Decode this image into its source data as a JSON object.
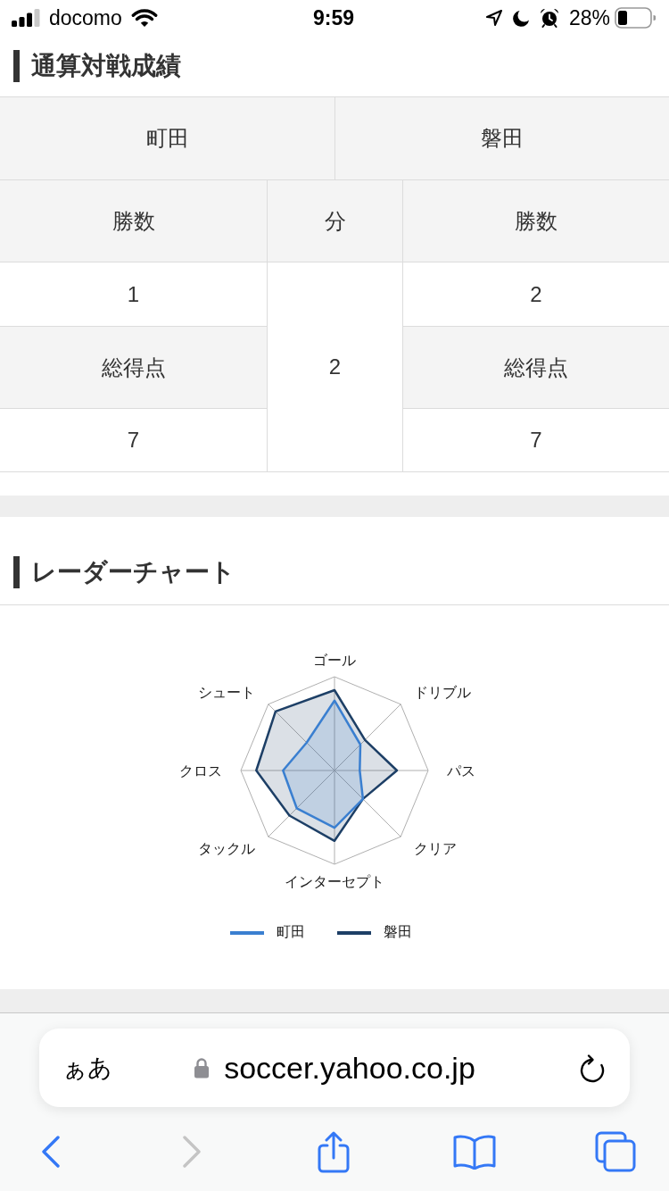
{
  "status_bar": {
    "carrier": "docomo",
    "time": "9:59",
    "battery_text": "28%"
  },
  "record_section": {
    "title": "通算対戦成績",
    "teams": [
      "町田",
      "磐田"
    ],
    "columns": [
      "勝数",
      "分",
      "勝数"
    ],
    "home_cells": [
      {
        "kind": "value",
        "text": "1"
      },
      {
        "kind": "label",
        "text": "総得点"
      },
      {
        "kind": "value",
        "text": "7"
      }
    ],
    "draws": "2",
    "away_cells": [
      {
        "kind": "value",
        "text": "2"
      },
      {
        "kind": "label",
        "text": "総得点"
      },
      {
        "kind": "value",
        "text": "7"
      }
    ]
  },
  "radar_section": {
    "title": "レーダーチャート",
    "axes": [
      "ゴール",
      "シュート",
      "ドリブル",
      "クロス",
      "パス",
      "タックル",
      "クリア",
      "インターセプト"
    ],
    "series": [
      {
        "name": "町田",
        "color": "#3a7fd0"
      },
      {
        "name": "磐田",
        "color": "#1d3f66"
      }
    ]
  },
  "browser": {
    "text_size_button": "ぁあ",
    "url": "soccer.yahoo.co.jp",
    "toolbar": [
      {
        "kind": "back",
        "disabled": false
      },
      {
        "kind": "forward",
        "disabled": true
      },
      {
        "kind": "share",
        "disabled": false
      },
      {
        "kind": "bookmarks",
        "disabled": false
      },
      {
        "kind": "tabs",
        "disabled": false
      }
    ]
  }
}
